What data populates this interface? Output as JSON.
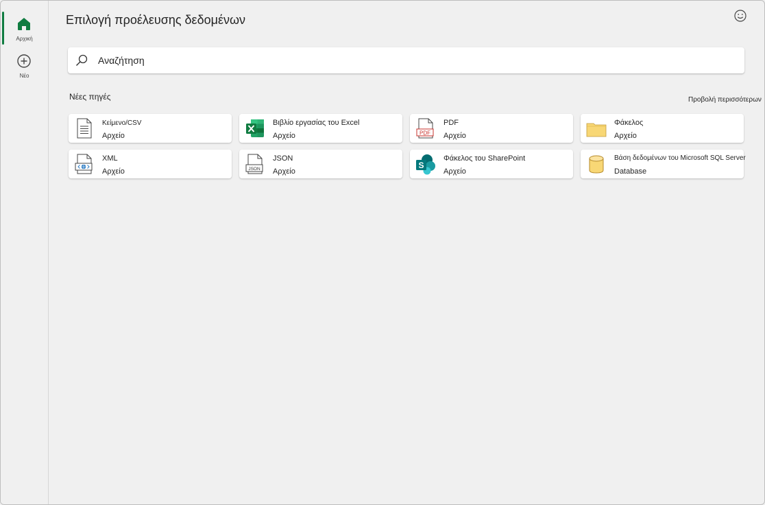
{
  "rail": {
    "items": [
      {
        "label": "Αρχική",
        "icon": "home-icon",
        "active": true
      },
      {
        "label": "Νέο",
        "icon": "plus-circle-icon",
        "active": false
      }
    ]
  },
  "header": {
    "title": "Επιλογή προέλευσης δεδομένων",
    "feedback_icon": "smiley-icon"
  },
  "search": {
    "placeholder": "Αναζήτηση",
    "icon": "search-icon"
  },
  "sources": {
    "section_label": "Νέες πηγές",
    "view_more": "Προβολή περισσότερων",
    "cards": [
      {
        "name": "Κείμενο/CSV",
        "type": "Αρχείο",
        "icon": "text-file-icon"
      },
      {
        "name": "Βιβλίο εργασίας του Excel",
        "type": "Αρχείο",
        "icon": "excel-icon"
      },
      {
        "name": "PDF",
        "type": "Αρχείο",
        "icon": "pdf-icon",
        "icon_text": "PDF"
      },
      {
        "name": "Φάκελος",
        "type": "Αρχείο",
        "icon": "folder-icon"
      },
      {
        "name": "XML",
        "type": "Αρχείο",
        "icon": "xml-icon"
      },
      {
        "name": "JSON",
        "type": "Αρχείο",
        "icon": "json-icon",
        "icon_text": "JSON"
      },
      {
        "name": "Φάκελος του SharePoint",
        "type": "Αρχείο",
        "icon": "sharepoint-icon",
        "icon_text": "S"
      },
      {
        "name": "Βάση δεδομένων του Microsoft SQL Server",
        "type": "Database",
        "icon": "sql-database-icon"
      }
    ]
  },
  "colors": {
    "accent": "#107c41",
    "excel_green": "#1d6f42",
    "sharepoint_teal": "#038387",
    "folder_yellow": "#f8d775",
    "pdf_red": "#c8312b"
  }
}
